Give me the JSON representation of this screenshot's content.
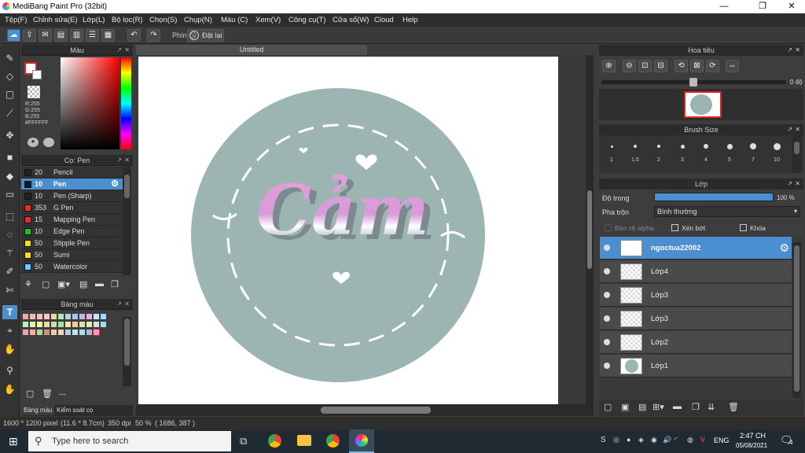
{
  "window": {
    "title": "MediBang Paint Pro (32bit)",
    "min": "—",
    "max": "❐",
    "close": "✕"
  },
  "menu": [
    "Tệp(F)",
    "Chỉnh sửa(E)",
    "Lớp(L)",
    "Bộ lọc(R)",
    "Chọn(S)",
    "Chụp(N)",
    "Màu (C)",
    "Xem(V)",
    "Công cụ(T)",
    "Cửa sổ(W)",
    "Cloud",
    "Help"
  ],
  "toolbar": {
    "key_label": "Phím",
    "reset_label": "Đặt lại"
  },
  "color_panel": {
    "title": "Màu",
    "r": "R:255",
    "g": "G:255",
    "b": "B:255",
    "hex": "#FFFFFF"
  },
  "brush_panel": {
    "title": "Cọ: Pen",
    "items": [
      {
        "size": "20",
        "name": "Pencil",
        "color": "#222222"
      },
      {
        "size": "10",
        "name": "Pen",
        "color": "#1a1a1a"
      },
      {
        "size": "10",
        "name": "Pen (Sharp)",
        "color": "#222222"
      },
      {
        "size": "353",
        "name": "G Pen",
        "color": "#e03030"
      },
      {
        "size": "15",
        "name": "Mapping Pen",
        "color": "#e03030"
      },
      {
        "size": "10",
        "name": "Edge Pen",
        "color": "#22bb22"
      },
      {
        "size": "50",
        "name": "Stipple Pen",
        "color": "#eedd22"
      },
      {
        "size": "50",
        "name": "Sumi",
        "color": "#eedd22"
      },
      {
        "size": "50",
        "name": "Watercolor",
        "color": "#66ccff"
      }
    ]
  },
  "palette_panel": {
    "title": "Bảng màu",
    "dash": "---",
    "colors": [
      "#f4a6a6",
      "#f7b6b6",
      "#f4c2c2",
      "#f7c6d0",
      "#f9d4a0",
      "#b6e3c9",
      "#a7d8e8",
      "#a6c8f0",
      "#c3b5f0",
      "#e0b5e8",
      "#bfe9f9",
      "#9fdcf4",
      "#b9f0c0",
      "#e2f5a5",
      "#f9f0a6",
      "#f8d8a0",
      "#c5e3a5",
      "#a0e6a0",
      "#f5e6a6",
      "#f9c8a6",
      "#e4e4a0",
      "#d9f0b8",
      "#c7e8f0",
      "#a8d8f7",
      "#f0a0c0",
      "#f7b0a0",
      "#b0d7a0",
      "#c29a80",
      "#f7c8a0",
      "#f5d5b0",
      "#b8c8e8",
      "#c0e0f0",
      "#a6e0f0",
      "#a0c0d8",
      "#e0a0e0"
    ]
  },
  "bottom_tabs": {
    "palette": "Bảng màu",
    "brush_control": "Kiểm soát cọ"
  },
  "document": {
    "tab": "Untitled",
    "artwork_text": "Cảm"
  },
  "navigator": {
    "title": "Hoa tiêu",
    "angle": "0 độ"
  },
  "brush_size": {
    "title": "Brush Size",
    "sizes": [
      "1",
      "1.5",
      "2",
      "3",
      "4",
      "5",
      "7",
      "10"
    ]
  },
  "layer_panel": {
    "title": "Lớp",
    "opacity_label": "Độ trong",
    "opacity_value": "100 %",
    "blend_label": "Pha trộn",
    "blend_value": "Bình thường",
    "protect_alpha": "Bảo vệ alpha",
    "clip": "Xén bớt",
    "lock": "Khóa",
    "layers": [
      "ngoctua22002",
      "Lớp4",
      "Lớp3",
      "Lớp3",
      "Lớp2",
      "Lớp1"
    ]
  },
  "status": {
    "dims": "1600 * 1200 pixel",
    "size": "(11.6 * 8.7cm)",
    "dpi": "350 dpi",
    "zoom": "50 %",
    "coords": "( 1686, 387 )"
  },
  "taskbar": {
    "search_placeholder": "Type here to search",
    "lang": "ENG",
    "time": "2:47 CH",
    "date": "05/08/2021",
    "notif_count": "4"
  }
}
